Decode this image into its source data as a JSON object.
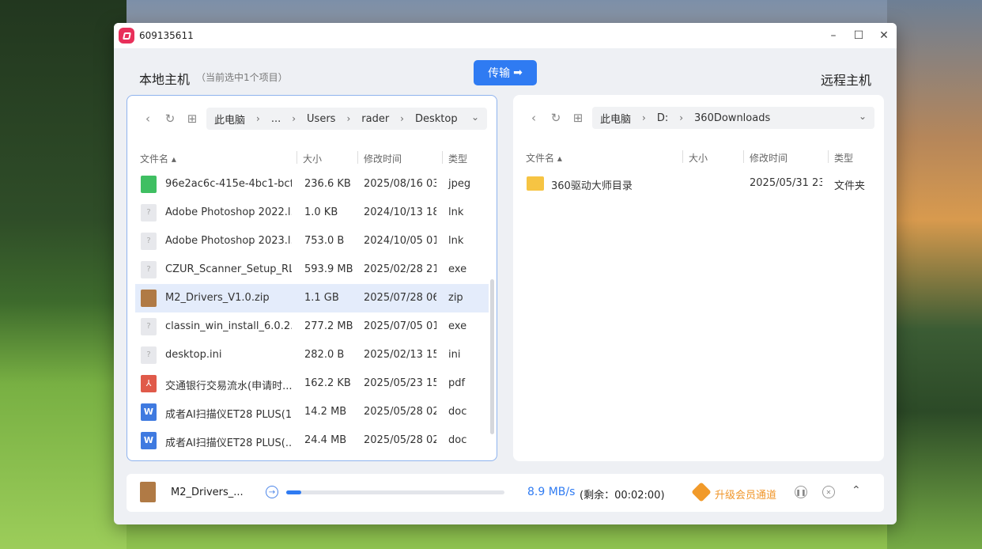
{
  "window": {
    "title": "609135611",
    "controls": [
      "–",
      "☐",
      "✕"
    ]
  },
  "header": {
    "local_title": "本地主机",
    "local_sub": "（当前选中1个项目）",
    "transfer_label": "传输",
    "remote_title": "远程主机"
  },
  "local": {
    "crumbs": [
      "此电脑",
      "...",
      "Users",
      "rader",
      "Desktop"
    ],
    "columns": [
      "文件名",
      "大小",
      "修改时间",
      "类型"
    ],
    "files": [
      {
        "name": "96e2ac6c-415e-4bc1-bcf...",
        "size": "236.6 KB",
        "date": "2025/08/16 03:...",
        "type": "jpeg",
        "icon": "image-file-icon"
      },
      {
        "name": "Adobe Photoshop 2022.l...",
        "size": "1.0 KB",
        "date": "2024/10/13 18:...",
        "type": "lnk",
        "icon": "generic-file-icon"
      },
      {
        "name": "Adobe Photoshop 2023.l...",
        "size": "753.0 B",
        "date": "2024/10/05 01:...",
        "type": "lnk",
        "icon": "generic-file-icon"
      },
      {
        "name": "CZUR_Scanner_Setup_RL...",
        "size": "593.9 MB",
        "date": "2025/02/28 21:...",
        "type": "exe",
        "icon": "generic-file-icon"
      },
      {
        "name": "M2_Drivers_V1.0.zip",
        "size": "1.1 GB",
        "date": "2025/07/28 06:...",
        "type": "zip",
        "icon": "zip-file-icon"
      },
      {
        "name": "classin_win_install_6.0.2....",
        "size": "277.2 MB",
        "date": "2025/07/05 01:...",
        "type": "exe",
        "icon": "generic-file-icon"
      },
      {
        "name": "desktop.ini",
        "size": "282.0 B",
        "date": "2025/02/13 15:...",
        "type": "ini",
        "icon": "generic-file-icon"
      },
      {
        "name": "交通银行交易流水(申请时...",
        "size": "162.2 KB",
        "date": "2025/05/23 15:...",
        "type": "pdf",
        "icon": "pdf-file-icon"
      },
      {
        "name": "成者AI扫描仪ET28 PLUS(1...",
        "size": "14.2 MB",
        "date": "2025/05/28 02:...",
        "type": "doc",
        "icon": "word-file-icon"
      },
      {
        "name": "成者AI扫描仪ET28 PLUS(...",
        "size": "24.4 MB",
        "date": "2025/05/28 02:...",
        "type": "doc",
        "icon": "word-file-icon"
      }
    ]
  },
  "remote": {
    "crumbs": [
      "此电脑",
      "D:",
      "360Downloads"
    ],
    "columns": [
      "文件名",
      "大小",
      "修改时间",
      "类型"
    ],
    "files": [
      {
        "name": "360驱动大师目录",
        "size": "",
        "date": "2025/05/31 23:...",
        "type": "文件夹",
        "icon": "folder-icon"
      }
    ]
  },
  "transfer": {
    "file_name": "M2_Drivers_...",
    "progress": 0.07,
    "speed": "8.9 MB/s",
    "remaining": "(剩余：00:02:00)",
    "vip_label": "升级会员通道"
  },
  "colors": {
    "accent": "#2f7bf2",
    "vip": "#f0962a",
    "selected_row": "#e4ecfb"
  }
}
